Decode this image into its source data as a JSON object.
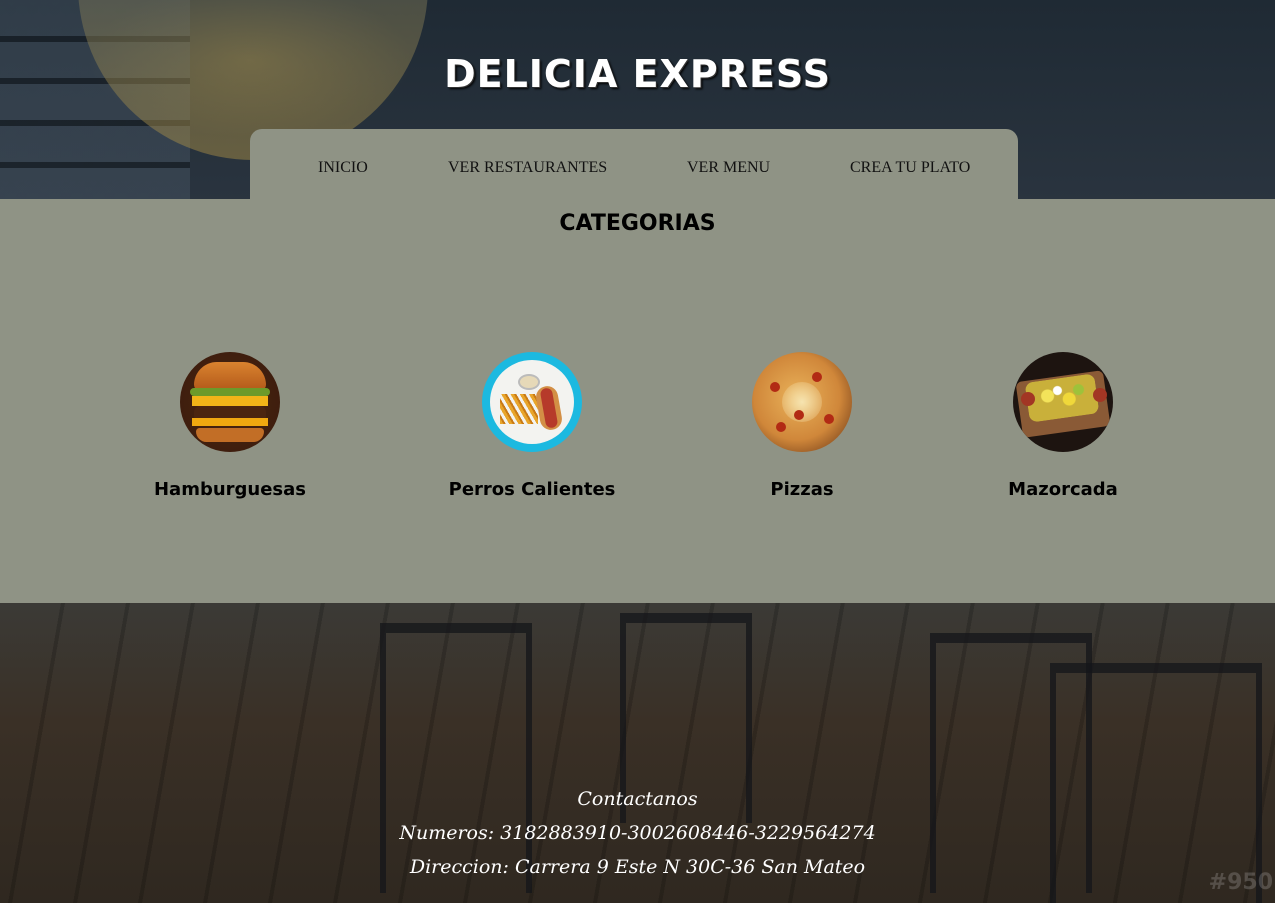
{
  "header": {
    "title": "DELICIA EXPRESS"
  },
  "nav": {
    "items": [
      {
        "label": "INICIO"
      },
      {
        "label": "VER RESTAURANTES"
      },
      {
        "label": "VER MENU"
      },
      {
        "label": "CREA TU PLATO"
      }
    ]
  },
  "main": {
    "section_title": "CATEGORIAS",
    "categories": [
      {
        "label": "Hamburguesas",
        "icon": "burger-image"
      },
      {
        "label": "Perros Calientes",
        "icon": "hotdog-image"
      },
      {
        "label": "Pizzas",
        "icon": "pizza-image"
      },
      {
        "label": "Mazorcada",
        "icon": "mazorcada-image"
      }
    ]
  },
  "footer": {
    "heading": "Contactanos",
    "phones": "Numeros: 3182883910-3002608446-3229564274",
    "address": "Direccion: Carrera 9 Este N 30C-36 San Mateo"
  },
  "watermark": "#950",
  "colors": {
    "panel": "#8f9385",
    "title_text": "#ffffff",
    "footer_text": "#ffffff"
  }
}
